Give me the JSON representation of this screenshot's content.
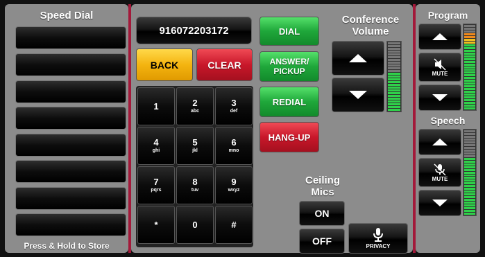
{
  "speed_dial": {
    "title": "Speed Dial",
    "footer": "Press & Hold to Store",
    "slot_count": 8
  },
  "dialer": {
    "number": "916072203172",
    "back_label": "BACK",
    "clear_label": "CLEAR",
    "dial_label": "DIAL",
    "answer_label_1": "ANSWER/",
    "answer_label_2": "PICKUP",
    "redial_label": "REDIAL",
    "hangup_label": "HANG-UP",
    "keys": [
      {
        "digit": "1",
        "letters": ""
      },
      {
        "digit": "2",
        "letters": "abc"
      },
      {
        "digit": "3",
        "letters": "def"
      },
      {
        "digit": "4",
        "letters": "ghi"
      },
      {
        "digit": "5",
        "letters": "jkl"
      },
      {
        "digit": "6",
        "letters": "mno"
      },
      {
        "digit": "7",
        "letters": "pqrs"
      },
      {
        "digit": "8",
        "letters": "tuv"
      },
      {
        "digit": "9",
        "letters": "wxyz"
      },
      {
        "digit": "*",
        "letters": ""
      },
      {
        "digit": "0",
        "letters": ""
      },
      {
        "digit": "#",
        "letters": ""
      }
    ]
  },
  "conference": {
    "title_1": "Conference",
    "title_2": "Volume",
    "level": 0.56
  },
  "ceiling": {
    "title_1": "Ceiling",
    "title_2": "Mics",
    "on_label": "ON",
    "off_label": "OFF",
    "privacy_label": "PRIVACY"
  },
  "program": {
    "title": "Program",
    "mute_label": "MUTE",
    "level": 0.9
  },
  "speech": {
    "title": "Speech",
    "mute_label": "MUTE",
    "level": 0.68
  },
  "colors": {
    "divider": "#a3193a",
    "panel": "#8c8c8c",
    "green": "#1fa73a",
    "red": "#c8172a",
    "yellow": "#f4b410"
  }
}
